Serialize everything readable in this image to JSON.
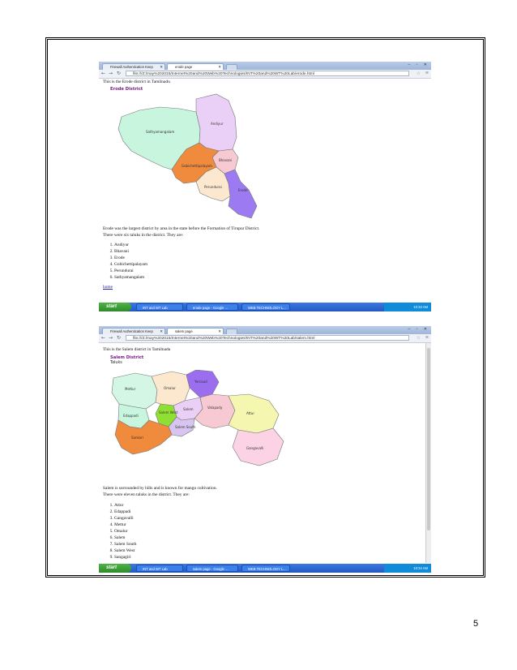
{
  "page_number": "5",
  "shot1": {
    "tabs": [
      "Firewall Authentication Keep",
      "erode page"
    ],
    "url": "file:///Z:/may%202015/Internet%20and%20Web%20Technologies/INT%20and%20WT%20Lab/erode.html",
    "intro": "This is the Erode district in Tamilnadu",
    "heading": "Erode District",
    "map_labels": [
      "Andiyur",
      "Sathyamangalam",
      "Bhavani",
      "Gobichettipalayam",
      "Perundurai",
      "Erode"
    ],
    "para1": "Erode was the largest district by area in the state before the Formation of Tirupur District.",
    "para2": "There were six taluks in the district. They are:",
    "taluks": [
      "Andiyur",
      "Bhavani",
      "Erode",
      "Gobichettipalayam",
      "Perundurai",
      "Sathyamangalam"
    ],
    "home_link": "home",
    "taskbar": {
      "start": "start",
      "tasks": [
        "INT and WT Lab",
        "erode page - Google ...",
        "WEB TECHNOLOGY L..."
      ],
      "time": "10:33 AM"
    }
  },
  "shot2": {
    "tabs": [
      "Firewall Authentication Keep",
      "salem page"
    ],
    "url": "file:///Z:/may%202015/Internet%20and%20Web%20Technologies/INT%20and%20WT%20Lab/salem.html",
    "intro": "This is the Salem district in Tamilnadu",
    "heading": "Salem District",
    "subheading": "Taluks",
    "map_labels": [
      "Mettur",
      "Omalur",
      "Yercaud",
      "Edappadi",
      "Salem West",
      "Salem",
      "Valapady",
      "Attur",
      "Sankari",
      "Salem South",
      "Gangavalli"
    ],
    "para1": "Salem is surrounded by hills and is known for mango cultivation.",
    "para2": "There were eleven taluks in the district. They are:",
    "taluks": [
      "Attur",
      "Edappadi",
      "Gangavalli",
      "Mettur",
      "Omalur",
      "Salem",
      "Salem South",
      "Salem West",
      "Sangagiri"
    ],
    "taskbar": {
      "start": "start",
      "tasks": [
        "INT and WT Lab",
        "salem page - Google ...",
        "WEB TECHNOLOGY L..."
      ],
      "time": "10:34 AM"
    }
  }
}
